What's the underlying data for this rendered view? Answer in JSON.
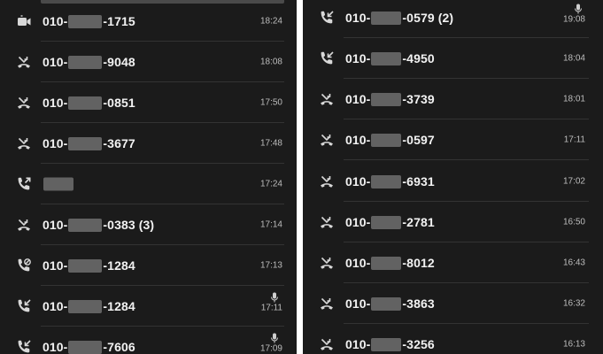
{
  "left_panel": {
    "calls": [
      {
        "type": "video",
        "prefix": "010-",
        "blur_width": 38,
        "suffix": "-1715",
        "extra": "",
        "time": "18:24",
        "mic": false
      },
      {
        "type": "missed",
        "prefix": "010-",
        "blur_width": 38,
        "suffix": "-9048",
        "extra": "",
        "time": "18:08",
        "mic": false
      },
      {
        "type": "missed",
        "prefix": "010-",
        "blur_width": 38,
        "suffix": "-0851",
        "extra": "",
        "time": "17:50",
        "mic": false
      },
      {
        "type": "missed",
        "prefix": "010-",
        "blur_width": 38,
        "suffix": "-3677",
        "extra": "",
        "time": "17:48",
        "mic": false
      },
      {
        "type": "outgoing",
        "prefix": "",
        "blur_width": 34,
        "suffix": "",
        "extra": "",
        "time": "17:24",
        "mic": false
      },
      {
        "type": "missed",
        "prefix": "010-",
        "blur_width": 38,
        "suffix": "-0383",
        "extra": " (3)",
        "time": "17:14",
        "mic": false
      },
      {
        "type": "blocked",
        "prefix": "010-",
        "blur_width": 38,
        "suffix": "-1284",
        "extra": "",
        "time": "17:13",
        "mic": false
      },
      {
        "type": "incoming",
        "prefix": "010-",
        "blur_width": 38,
        "suffix": "-1284",
        "extra": "",
        "time": "17:11",
        "mic": true
      },
      {
        "type": "incoming",
        "prefix": "010-",
        "blur_width": 38,
        "suffix": "-7606",
        "extra": "",
        "time": "17:09",
        "mic": true
      }
    ]
  },
  "right_panel": {
    "calls": [
      {
        "type": "incoming",
        "prefix": "010-",
        "blur_width": 34,
        "suffix": "-0579",
        "extra": " (2)",
        "time": "19:08",
        "mic": true
      },
      {
        "type": "incoming",
        "prefix": "010-",
        "blur_width": 34,
        "suffix": "-4950",
        "extra": "",
        "time": "18:04",
        "mic": false
      },
      {
        "type": "missed",
        "prefix": "010-",
        "blur_width": 34,
        "suffix": "-3739",
        "extra": "",
        "time": "18:01",
        "mic": false
      },
      {
        "type": "missed",
        "prefix": "010-",
        "blur_width": 34,
        "suffix": "-0597",
        "extra": "",
        "time": "17:11",
        "mic": false
      },
      {
        "type": "missed",
        "prefix": "010-",
        "blur_width": 34,
        "suffix": "-6931",
        "extra": "",
        "time": "17:02",
        "mic": false
      },
      {
        "type": "missed",
        "prefix": "010-",
        "blur_width": 34,
        "suffix": "-2781",
        "extra": "",
        "time": "16:50",
        "mic": false
      },
      {
        "type": "missed",
        "prefix": "010-",
        "blur_width": 34,
        "suffix": "-8012",
        "extra": "",
        "time": "16:43",
        "mic": false
      },
      {
        "type": "missed",
        "prefix": "010-",
        "blur_width": 34,
        "suffix": "-3863",
        "extra": "",
        "time": "16:32",
        "mic": false
      },
      {
        "type": "missed",
        "prefix": "010-",
        "blur_width": 34,
        "suffix": "-3256",
        "extra": "",
        "time": "16:13",
        "mic": false
      }
    ]
  },
  "icons": {
    "video": "video-call-icon",
    "missed": "missed-call-icon",
    "outgoing": "outgoing-call-icon",
    "incoming": "incoming-call-icon",
    "blocked": "blocked-call-icon",
    "mic": "recording-mic-icon"
  },
  "colors": {
    "background": "#1b1b1b",
    "text": "#f2f2f2",
    "time": "#bdbdbd",
    "icon": "#d8d8d8",
    "divider": "#333333"
  }
}
